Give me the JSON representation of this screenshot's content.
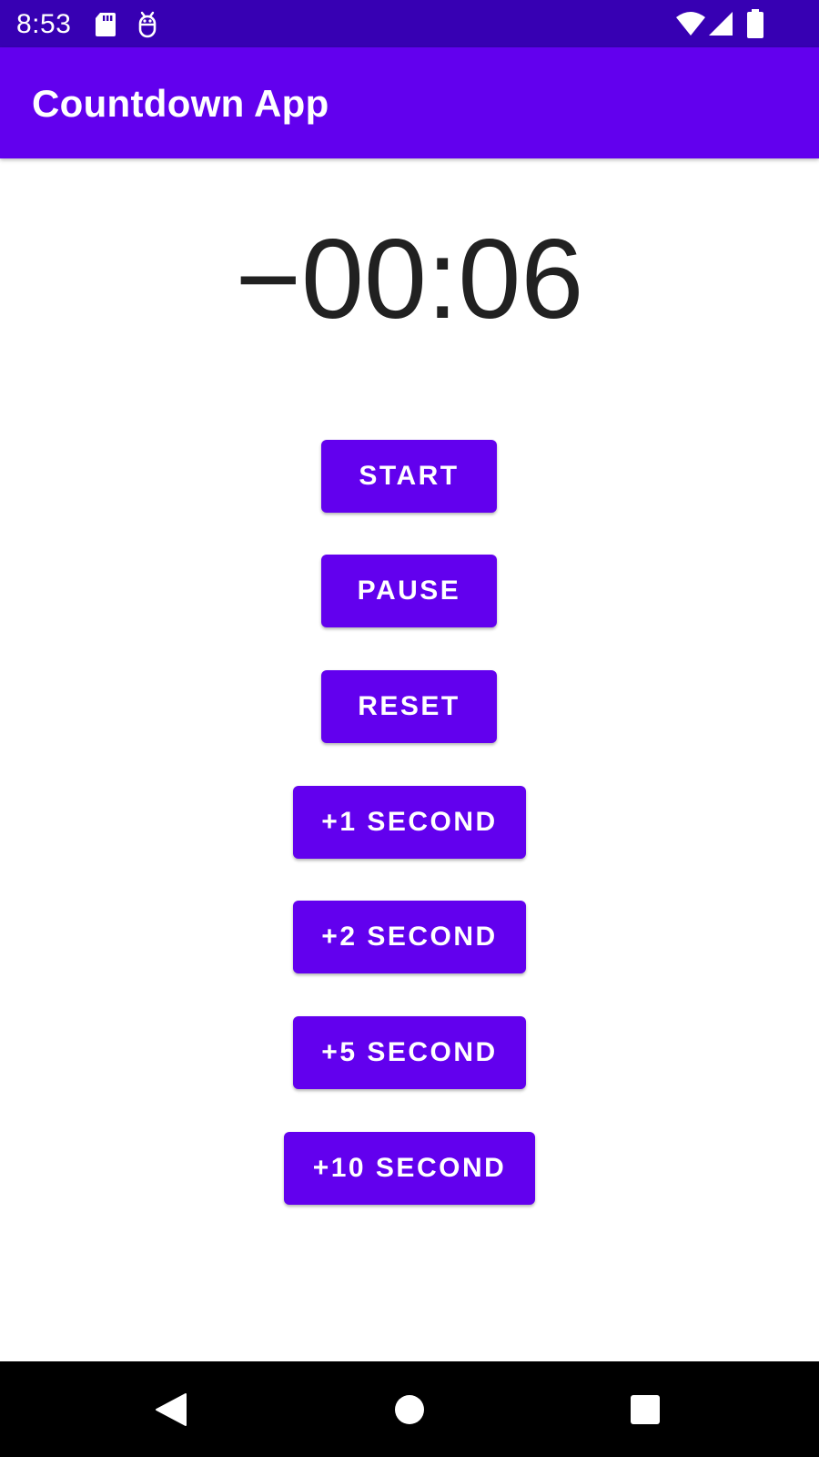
{
  "status_bar": {
    "time": "8:53",
    "icons": [
      "sd-card-icon",
      "android-debug-icon",
      "wifi-icon",
      "cellular-signal-icon",
      "battery-icon"
    ]
  },
  "app_bar": {
    "title": "Countdown App"
  },
  "timer": {
    "display": "−00:06"
  },
  "buttons": {
    "start": "START",
    "pause": "PAUSE",
    "reset": "RESET",
    "plus1": "+1 SECOND",
    "plus2": "+2 SECOND",
    "plus5": "+5 SECOND",
    "plus10": "+10 SECOND"
  },
  "nav_bar": {
    "icons": [
      "back-icon",
      "home-icon",
      "recents-icon"
    ]
  },
  "colors": {
    "status_bar": "#3700b3",
    "primary": "#6200ee",
    "timer_text": "#212121",
    "nav_bar": "#000000"
  }
}
